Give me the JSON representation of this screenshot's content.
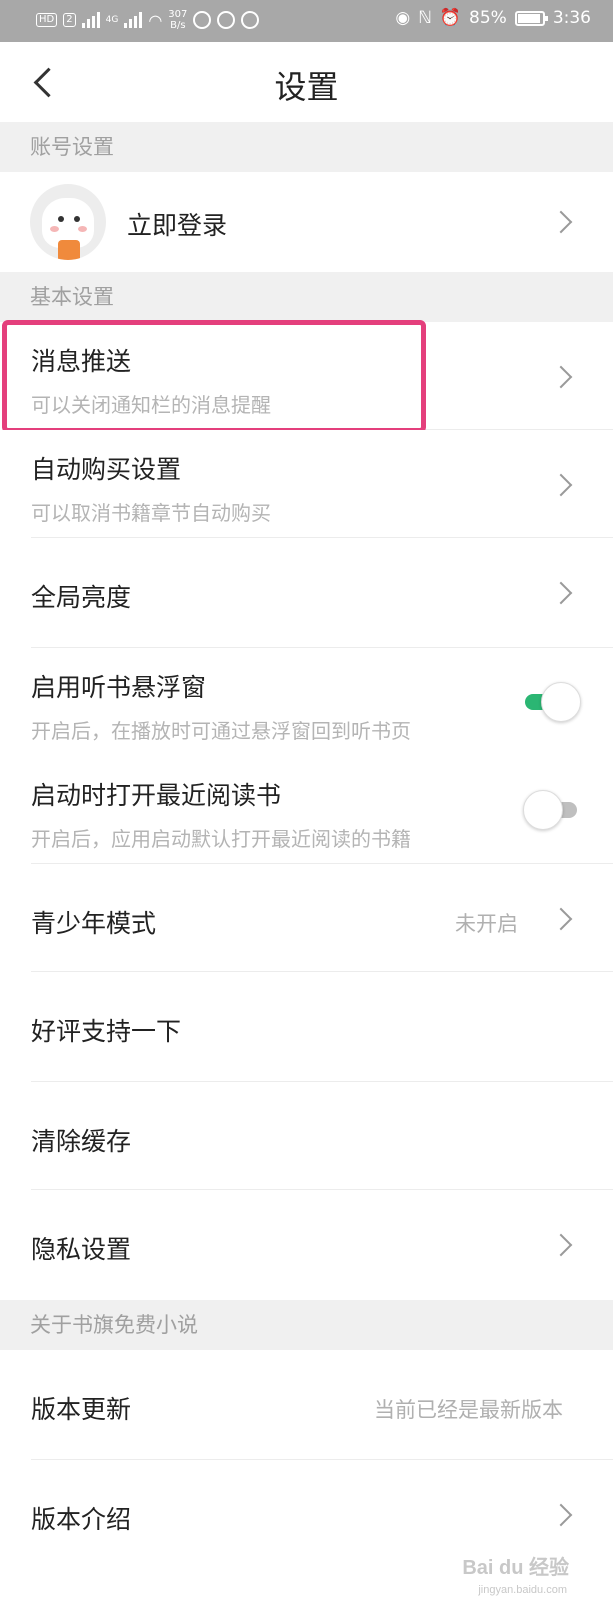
{
  "status_bar": {
    "chip_hd": "HD",
    "chip_2": "2",
    "signal_label": "4G",
    "speed": "307",
    "speed_unit": "B/s",
    "battery": "85%",
    "time": "3:36"
  },
  "nav": {
    "title": "设置"
  },
  "sections": {
    "account": "账号设置",
    "basic": "基本设置",
    "about": "关于书旗免费小说"
  },
  "account_row": {
    "label": "立即登录"
  },
  "rows": {
    "push": {
      "title": "消息推送",
      "subtitle": "可以关闭通知栏的消息提醒"
    },
    "auto_buy": {
      "title": "自动购买设置",
      "subtitle": "可以取消书籍章节自动购买"
    },
    "brightness": {
      "title": "全局亮度"
    },
    "listen_float": {
      "title": "启用听书悬浮窗",
      "subtitle": "开启后，在播放时可通过悬浮窗回到听书页",
      "enabled": true
    },
    "open_recent": {
      "title": "启动时打开最近阅读书",
      "subtitle": "开启后，应用启动默认打开最近阅读的书籍",
      "enabled": false
    },
    "youth_mode": {
      "title": "青少年模式",
      "value": "未开启"
    },
    "rate": {
      "title": "好评支持一下"
    },
    "clear_cache": {
      "title": "清除缓存"
    },
    "privacy": {
      "title": "隐私设置"
    },
    "version_update": {
      "title": "版本更新",
      "value": "当前已经是最新版本"
    },
    "version_intro": {
      "title": "版本介绍"
    }
  },
  "colors": {
    "toggle_on": "#2bb673",
    "highlight": "#e43f7c",
    "section_bg": "#f0f0f0"
  },
  "watermark": {
    "text": "Bai du 经验",
    "sub": "jingyan.baidu.com"
  }
}
